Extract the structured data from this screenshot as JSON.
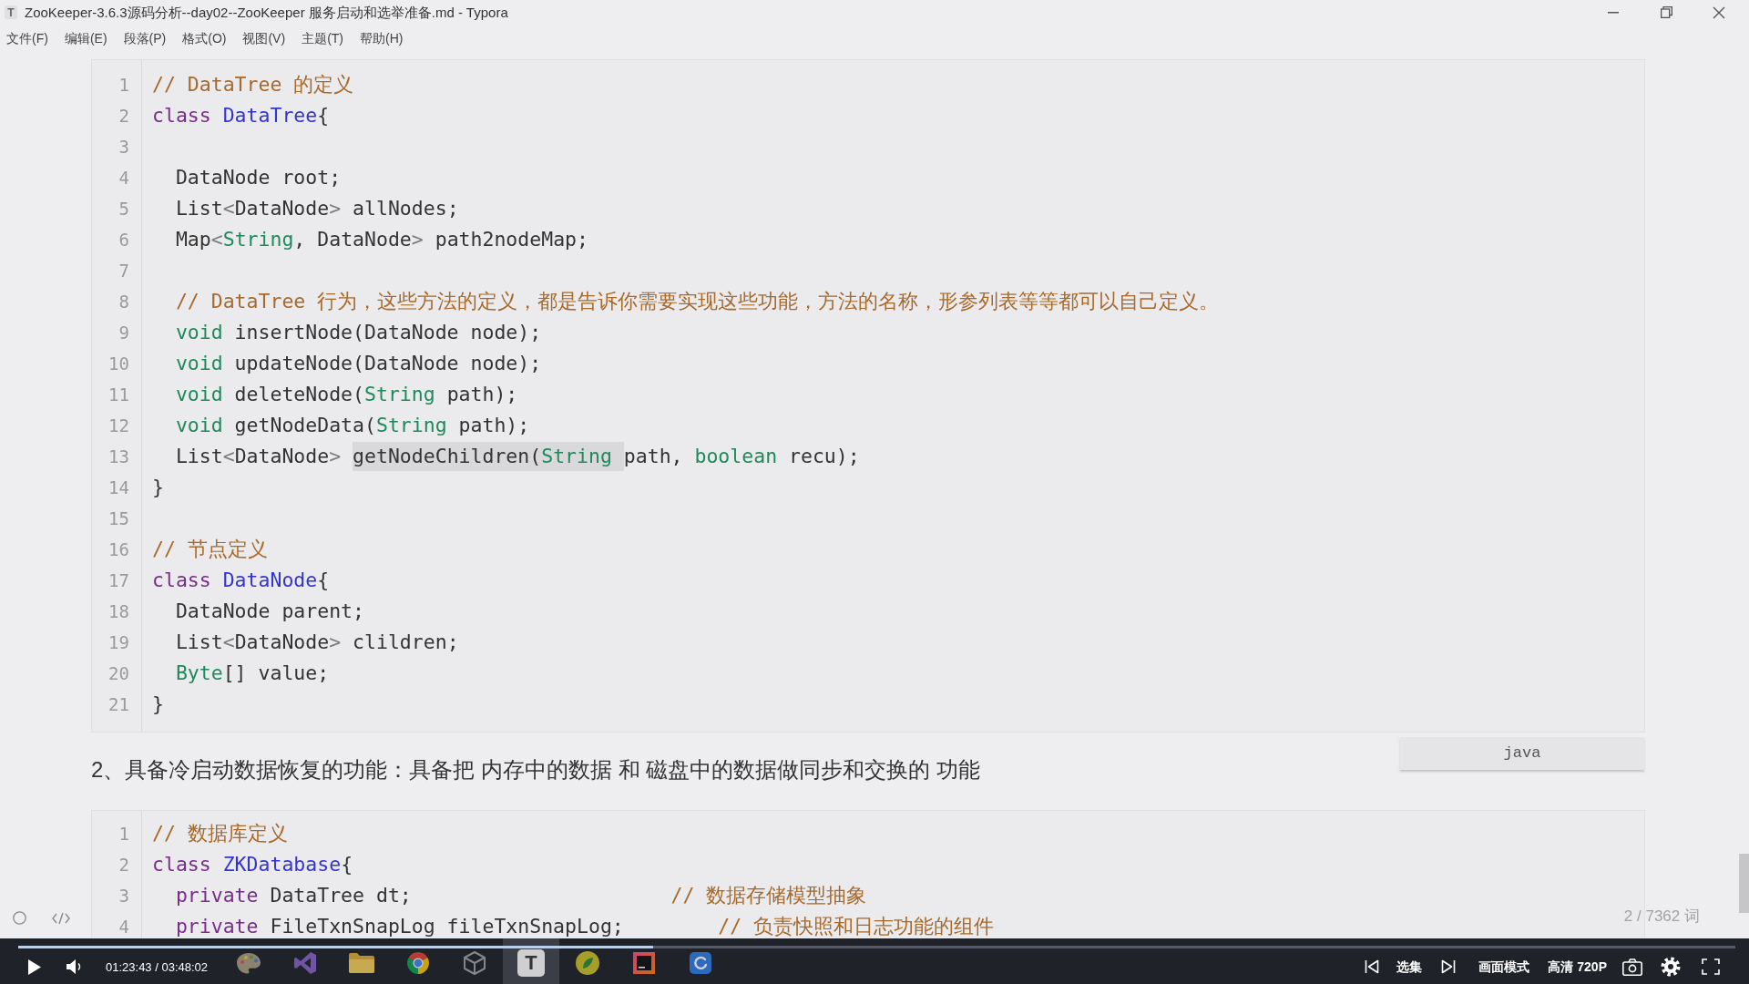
{
  "window": {
    "app_icon": "T",
    "title": "ZooKeeper-3.6.3源码分析--day02--ZooKeeper 服务启动和选举准备.md - Typora"
  },
  "menu": [
    "文件(F)",
    "编辑(E)",
    "段落(P)",
    "格式(O)",
    "视图(V)",
    "主题(T)",
    "帮助(H)"
  ],
  "document": [
    {
      "kind": "code",
      "language": "java",
      "lines": [
        {
          "number": "1",
          "tokens": [
            {
              "kind": "comment",
              "text": "// DataTree 的定义"
            }
          ]
        },
        {
          "number": "2",
          "tokens": [
            {
              "kind": "keyword",
              "text": "class"
            },
            {
              "kind": "def",
              "text": " DataTree"
            },
            {
              "kind": "plain",
              "text": "{"
            }
          ]
        },
        {
          "number": "3"
        },
        {
          "number": "4",
          "tokens": [
            {
              "kind": "plain",
              "text": "  DataNode root;"
            }
          ]
        },
        {
          "number": "5",
          "tokens": [
            {
              "kind": "plain",
              "text": "  List"
            },
            {
              "kind": "operator",
              "text": "<"
            },
            {
              "kind": "plain",
              "text": "DataNode"
            },
            {
              "kind": "operator",
              "text": ">"
            },
            {
              "kind": "plain",
              "text": " allNodes;"
            }
          ]
        },
        {
          "number": "6",
          "tokens": [
            {
              "kind": "plain",
              "text": "  Map"
            },
            {
              "kind": "operator",
              "text": "<"
            },
            {
              "kind": "type",
              "text": "String"
            },
            {
              "kind": "plain",
              "text": ", DataNode"
            },
            {
              "kind": "operator",
              "text": ">"
            },
            {
              "kind": "plain",
              "text": " path2nodeMap;"
            }
          ]
        },
        {
          "number": "7"
        },
        {
          "number": "8",
          "tokens": [
            {
              "kind": "comment",
              "text": "  // DataTree 行为，这些方法的定义，都是告诉你需要实现这些功能，方法的名称，形参列表等等都可以自己定义。"
            }
          ]
        },
        {
          "number": "9",
          "tokens": [
            {
              "kind": "type",
              "text": "  void"
            },
            {
              "kind": "plain",
              "text": " insertNode(DataNode node);"
            }
          ]
        },
        {
          "number": "10",
          "tokens": [
            {
              "kind": "type",
              "text": "  void"
            },
            {
              "kind": "plain",
              "text": " updateNode(DataNode node);"
            }
          ]
        },
        {
          "number": "11",
          "tokens": [
            {
              "kind": "type",
              "text": "  void"
            },
            {
              "kind": "plain",
              "text": " deleteNode("
            },
            {
              "kind": "type",
              "text": "String"
            },
            {
              "kind": "plain",
              "text": " path);"
            }
          ]
        },
        {
          "number": "12",
          "tokens": [
            {
              "kind": "type",
              "text": "  void"
            },
            {
              "kind": "plain",
              "text": " getNodeData("
            },
            {
              "kind": "type",
              "text": "String"
            },
            {
              "kind": "plain",
              "text": " path);"
            }
          ]
        },
        {
          "number": "13",
          "tokens": [
            {
              "kind": "plain",
              "text": "  List",
              "highlighted": false
            },
            {
              "kind": "operator",
              "text": "<",
              "highlighted": false
            },
            {
              "kind": "plain",
              "text": "DataNode",
              "highlighted": false
            },
            {
              "kind": "operator",
              "text": "> ",
              "highlighted": false
            },
            {
              "kind": "plain",
              "text": "getNodeChildren(",
              "highlighted": true
            },
            {
              "kind": "type",
              "text": "String ",
              "highlighted": true
            },
            {
              "kind": "plain",
              "text": "path, ",
              "highlighted": false
            },
            {
              "kind": "type",
              "text": "boolean",
              "highlighted": false
            },
            {
              "kind": "plain",
              "text": " recu);",
              "highlighted": false
            }
          ]
        },
        {
          "number": "14",
          "tokens": [
            {
              "kind": "plain",
              "text": "}"
            }
          ]
        },
        {
          "number": "15"
        },
        {
          "number": "16",
          "tokens": [
            {
              "kind": "comment",
              "text": "// 节点定义"
            }
          ]
        },
        {
          "number": "17",
          "tokens": [
            {
              "kind": "keyword",
              "text": "class"
            },
            {
              "kind": "def",
              "text": " DataNode"
            },
            {
              "kind": "plain",
              "text": "{"
            }
          ]
        },
        {
          "number": "18",
          "tokens": [
            {
              "kind": "plain",
              "text": "  DataNode parent;"
            }
          ]
        },
        {
          "number": "19",
          "tokens": [
            {
              "kind": "plain",
              "text": "  List"
            },
            {
              "kind": "operator",
              "text": "<"
            },
            {
              "kind": "plain",
              "text": "DataNode"
            },
            {
              "kind": "operator",
              "text": ">"
            },
            {
              "kind": "plain",
              "text": " clildren;"
            }
          ]
        },
        {
          "number": "20",
          "tokens": [
            {
              "kind": "type",
              "text": "  Byte"
            },
            {
              "kind": "plain",
              "text": "[] value;"
            }
          ]
        },
        {
          "number": "21",
          "tokens": [
            {
              "kind": "plain",
              "text": "}"
            }
          ]
        }
      ]
    },
    {
      "kind": "paragraph",
      "text": "2、具备冷启动数据恢复的功能：具备把 内存中的数据 和 磁盘中的数据做同步和交换的 功能"
    },
    {
      "kind": "code",
      "lines": [
        {
          "number": "1",
          "tokens": [
            {
              "kind": "comment",
              "text": "// 数据库定义"
            }
          ]
        },
        {
          "number": "2",
          "tokens": [
            {
              "kind": "keyword",
              "text": "class"
            },
            {
              "kind": "def",
              "text": " ZKDatabase"
            },
            {
              "kind": "plain",
              "text": "{"
            }
          ]
        },
        {
          "number": "3",
          "tokens": [
            {
              "kind": "keyword",
              "text": "  private"
            },
            {
              "kind": "plain",
              "text": " DataTree dt;                      "
            },
            {
              "kind": "comment",
              "text": "// 数据存储模型抽象"
            }
          ]
        },
        {
          "number": "4",
          "tokens": [
            {
              "kind": "keyword",
              "text": "  private"
            },
            {
              "kind": "plain",
              "text": " FileTxnSnapLog fileTxnSnapLog;        "
            },
            {
              "kind": "comment",
              "text": "// 负责快照和日志功能的组件"
            }
          ]
        }
      ]
    }
  ],
  "status_bar": {
    "word_count": "2 / 7362 词"
  },
  "taskbar": {
    "items": [
      {
        "selected": false
      },
      {
        "selected": false
      },
      {
        "selected": false
      },
      {
        "selected": false
      },
      {
        "selected": false
      },
      {
        "label": "T",
        "selected": true
      },
      {
        "selected": false
      },
      {
        "selected": false
      },
      {
        "selected": false
      }
    ]
  },
  "player": {
    "playing": false,
    "time": "01:23:43 / 03:48:02",
    "progress": {
      "level": 0.37
    },
    "episodes_button": "选集",
    "picture_mode_button": "画面模式",
    "quality_button": "高清 720P"
  }
}
